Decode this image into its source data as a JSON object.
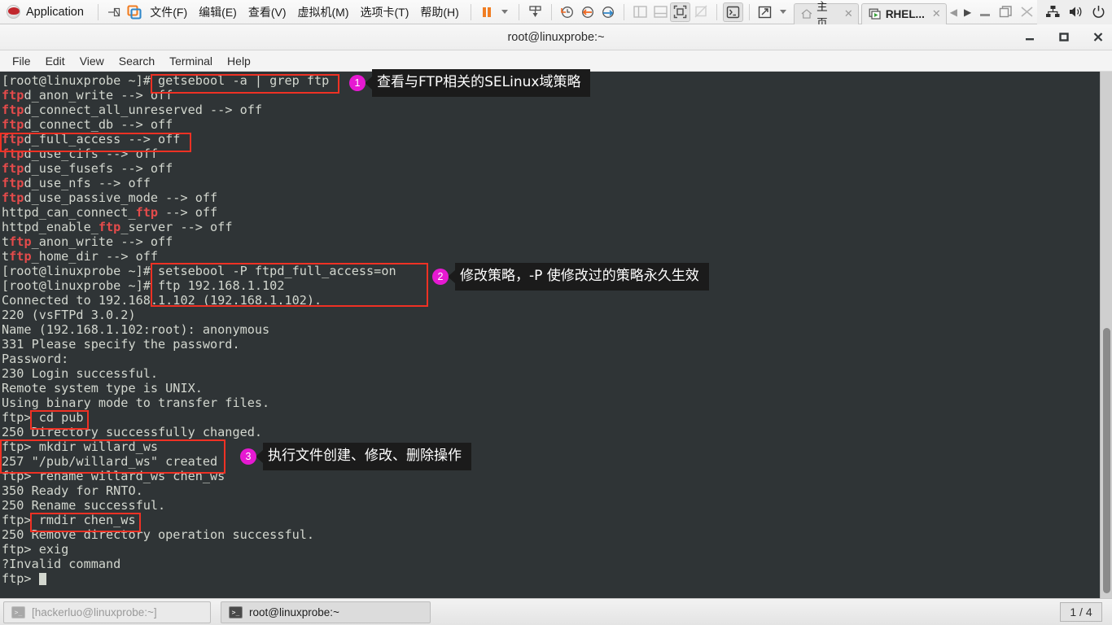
{
  "vmware": {
    "app_label": "Application",
    "menus": [
      "文件(F)",
      "编辑(E)",
      "查看(V)",
      "虚拟机(M)",
      "选项卡(T)",
      "帮助(H)"
    ],
    "tabs": [
      {
        "label": "主页",
        "icon": "home-icon",
        "active": false
      },
      {
        "label": "RHEL...",
        "icon": "vm-power-icon",
        "active": true
      }
    ]
  },
  "terminal": {
    "title": "root@linuxprobe:~",
    "menu": [
      "File",
      "Edit",
      "View",
      "Search",
      "Terminal",
      "Help"
    ],
    "lines": [
      [
        {
          "t": "[root@linuxprobe ~]# getsebool -a | grep ftp"
        }
      ],
      [
        {
          "t": "ftp",
          "m": true
        },
        {
          "t": "d_anon_write --> off"
        }
      ],
      [
        {
          "t": "ftp",
          "m": true
        },
        {
          "t": "d_connect_all_unreserved --> off"
        }
      ],
      [
        {
          "t": "ftp",
          "m": true
        },
        {
          "t": "d_connect_db --> off"
        }
      ],
      [
        {
          "t": "ftp",
          "m": true
        },
        {
          "t": "d_full_access --> off"
        }
      ],
      [
        {
          "t": "ftp",
          "m": true
        },
        {
          "t": "d_use_cifs --> off"
        }
      ],
      [
        {
          "t": "ftp",
          "m": true
        },
        {
          "t": "d_use_fusefs --> off"
        }
      ],
      [
        {
          "t": "ftp",
          "m": true
        },
        {
          "t": "d_use_nfs --> off"
        }
      ],
      [
        {
          "t": "ftp",
          "m": true
        },
        {
          "t": "d_use_passive_mode --> off"
        }
      ],
      [
        {
          "t": "httpd_can_connect_"
        },
        {
          "t": "ftp",
          "m": true
        },
        {
          "t": " --> off"
        }
      ],
      [
        {
          "t": "httpd_enable_"
        },
        {
          "t": "ftp",
          "m": true
        },
        {
          "t": "_server --> off"
        }
      ],
      [
        {
          "t": "t"
        },
        {
          "t": "ftp",
          "m": true
        },
        {
          "t": "_anon_write --> off"
        }
      ],
      [
        {
          "t": "t"
        },
        {
          "t": "ftp",
          "m": true
        },
        {
          "t": "_home_dir --> off"
        }
      ],
      [
        {
          "t": "[root@linuxprobe ~]# setsebool -P ftpd_full_access=on"
        }
      ],
      [
        {
          "t": "[root@linuxprobe ~]# ftp 192.168.1.102"
        }
      ],
      [
        {
          "t": "Connected to 192.168.1.102 (192.168.1.102)."
        }
      ],
      [
        {
          "t": "220 (vsFTPd 3.0.2)"
        }
      ],
      [
        {
          "t": "Name (192.168.1.102:root): anonymous"
        }
      ],
      [
        {
          "t": "331 Please specify the password."
        }
      ],
      [
        {
          "t": "Password:"
        }
      ],
      [
        {
          "t": "230 Login successful."
        }
      ],
      [
        {
          "t": "Remote system type is UNIX."
        }
      ],
      [
        {
          "t": "Using binary mode to transfer files."
        }
      ],
      [
        {
          "t": "ftp> cd pub"
        }
      ],
      [
        {
          "t": "250 Directory successfully changed."
        }
      ],
      [
        {
          "t": "ftp> mkdir willard_ws"
        }
      ],
      [
        {
          "t": "257 \"/pub/willard_ws\" created"
        }
      ],
      [
        {
          "t": "ftp> rename willard_ws chen_ws"
        }
      ],
      [
        {
          "t": "350 Ready for RNTO."
        }
      ],
      [
        {
          "t": "250 Rename successful."
        }
      ],
      [
        {
          "t": "ftp> rmdir chen_ws"
        }
      ],
      [
        {
          "t": "250 Remove directory operation successful."
        }
      ],
      [
        {
          "t": "ftp> exig"
        }
      ],
      [
        {
          "t": "?Invalid command"
        }
      ],
      [
        {
          "t": "ftp> ",
          "cursor": true
        }
      ]
    ]
  },
  "callouts": [
    {
      "num": "1",
      "text": "查看与FTP相关的SELinux域策略"
    },
    {
      "num": "2",
      "text": "修改策略，-P 使修改过的策略永久生效"
    },
    {
      "num": "3",
      "text": "执行文件创建、修改、删除操作"
    }
  ],
  "taskbar": {
    "items": [
      {
        "label": "[hackerluo@linuxprobe:~]",
        "active": false
      },
      {
        "label": "root@linuxprobe:~",
        "active": true
      }
    ],
    "workspace": "1 / 4"
  },
  "colors": {
    "highlight_box": "#ef3124",
    "callout_badge": "#e619d2",
    "terminal_bg": "#2f3436",
    "grep_match": "#e44b4b"
  }
}
